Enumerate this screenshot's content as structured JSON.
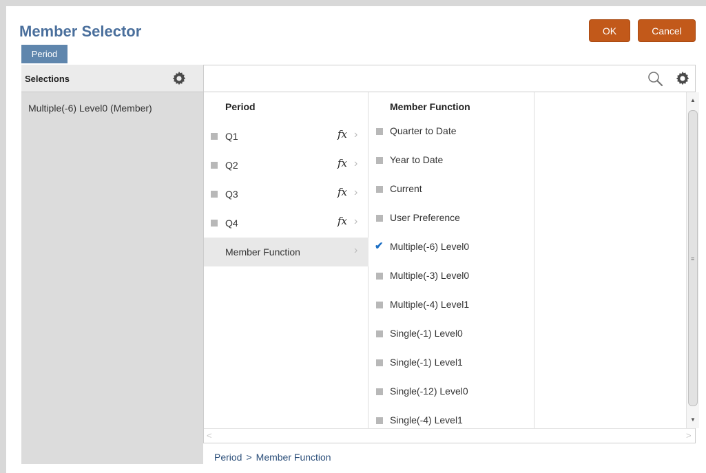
{
  "dialog": {
    "title": "Member Selector",
    "dimension_tab": "Period",
    "ok_label": "OK",
    "cancel_label": "Cancel"
  },
  "selections": {
    "title": "Selections",
    "items": [
      "Multiple(-6) Level0 (Member)"
    ]
  },
  "columns": {
    "period": {
      "header": "Period",
      "rows": [
        {
          "label": "Q1",
          "has_fx": true
        },
        {
          "label": "Q2",
          "has_fx": true
        },
        {
          "label": "Q3",
          "has_fx": true
        },
        {
          "label": "Q4",
          "has_fx": true
        },
        {
          "label": "Member Function",
          "active": true
        }
      ],
      "fx_glyph": "fx",
      "chevron": "›"
    },
    "member_function": {
      "header": "Member Function",
      "rows": [
        {
          "label": "Quarter to Date",
          "checked": false
        },
        {
          "label": "Year to Date",
          "checked": false
        },
        {
          "label": "Current",
          "checked": false
        },
        {
          "label": "User Preference",
          "checked": false
        },
        {
          "label": "Multiple(-6) Level0",
          "checked": true
        },
        {
          "label": "Multiple(-3) Level0",
          "checked": false
        },
        {
          "label": "Multiple(-4) Level1",
          "checked": false
        },
        {
          "label": "Single(-1) Level0",
          "checked": false
        },
        {
          "label": "Single(-1) Level1",
          "checked": false
        },
        {
          "label": "Single(-12) Level0",
          "checked": false
        },
        {
          "label": "Single(-4) Level1",
          "checked": false
        }
      ],
      "check_glyph": "✔"
    }
  },
  "breadcrumb": {
    "items": [
      "Period",
      "Member Function"
    ],
    "separator": ">"
  },
  "icons": {
    "gear": "gear-icon",
    "search": "search-icon"
  },
  "colors": {
    "title": "#4a6f9c",
    "tab": "#5f86ad",
    "button": "#c2591a",
    "check": "#1d6fc4",
    "breadcrumb": "#2c4f7a"
  }
}
